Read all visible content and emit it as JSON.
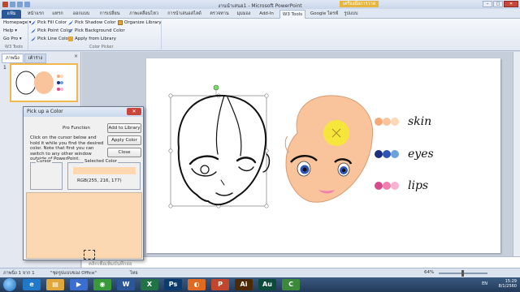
{
  "window": {
    "title": "งานนำเสนอ1 - Microsoft PowerPoint",
    "minimize": "–",
    "maximize": "□",
    "close": "✕"
  },
  "tabs": [
    {
      "label": "แฟ้ม",
      "kind": "file"
    },
    {
      "label": "หน้าแรก"
    },
    {
      "label": "แทรก"
    },
    {
      "label": "ออกแบบ"
    },
    {
      "label": "การเปลี่ยน"
    },
    {
      "label": "ภาพเคลื่อนไหว"
    },
    {
      "label": "การนำเสนอสไลด์"
    },
    {
      "label": "ตรวจทาน"
    },
    {
      "label": "มุมมอง"
    },
    {
      "label": "Add-In"
    },
    {
      "label": "W3 Tools",
      "kind": "active"
    },
    {
      "label": "Google ไดรฟ์"
    },
    {
      "label": "รูปแบบ"
    }
  ],
  "context_tab": "เครื่องมือการวาด",
  "ribbon": {
    "w3tools_group": {
      "items": [
        "Homepage ▾",
        "Help ▾",
        "Go Pro ▾"
      ],
      "name": "W3 Tools"
    },
    "color_picker_group": {
      "items": [
        {
          "label": "Pick Fill Color",
          "icon": "fill-picker-icon"
        },
        {
          "label": "Pick Point Color",
          "icon": "point-picker-icon"
        },
        {
          "label": "Pick Line Color",
          "icon": "line-picker-icon"
        },
        {
          "label": "Pick Shadow Color",
          "icon": "shadow-picker-icon"
        },
        {
          "label": "Pick Background Color",
          "icon": "background-picker-icon"
        },
        {
          "label": "Apply from Library",
          "icon": "library-apply-icon"
        },
        {
          "label": "Organize Library",
          "icon": "organize-library-icon"
        }
      ],
      "name": "Color Picker"
    }
  },
  "leftpane": {
    "tabs": [
      "ภาพนิ่ง",
      "เค้าร่าง"
    ],
    "close": "×",
    "slide_number": "1"
  },
  "slide": {
    "labels": [
      {
        "text": "skin",
        "colors": [
          "#f6a977",
          "#f9c49c",
          "#fcd8b5"
        ]
      },
      {
        "text": "eyes",
        "colors": [
          "#1c2f7c",
          "#2e55b6",
          "#6da3d9"
        ]
      },
      {
        "text": "lips",
        "colors": [
          "#d94a8c",
          "#ef7fae",
          "#f7b3cf"
        ]
      }
    ]
  },
  "dialog": {
    "title": "Pick up a Color",
    "close": "✕",
    "pro_function": "Pro Function",
    "add_to_library": "Add to Library",
    "apply_color": "Apply Color",
    "close_btn": "Close",
    "instructions": "Click on the cursor below and hold it while you find the desired color. Note that first you can switch to any other window outside of PowerPoint.",
    "cursor_label": "Cursor",
    "selected_label": "Selected Color",
    "rgb": "RGB(255, 216, 177)",
    "selected_color": "#ffd8b1"
  },
  "notes": "คลิกเพื่อเพิ่มบันทึกย่อ",
  "status": {
    "slide_info": "ภาพนิ่ง 1 จาก 1",
    "theme": "\"ชุดรูปแบบของ Office\"",
    "language": "ไทย",
    "zoom": "64%"
  },
  "tray": {
    "lang": "EN",
    "time": "15:29",
    "date": "8/1/2560"
  },
  "taskbar_apps": [
    {
      "name": "ie-icon",
      "glyph": "e",
      "color": "#1f78c8"
    },
    {
      "name": "explorer-icon",
      "glyph": "▤",
      "color": "#e0a83a"
    },
    {
      "name": "media-player-icon",
      "glyph": "▶",
      "color": "#3a6fd0"
    },
    {
      "name": "chrome-icon",
      "glyph": "◉",
      "color": "#3a9a3a"
    },
    {
      "name": "word-icon",
      "glyph": "W",
      "color": "#2b579a"
    },
    {
      "name": "excel-icon",
      "glyph": "X",
      "color": "#217346"
    },
    {
      "name": "photoshop-icon",
      "glyph": "Ps",
      "color": "#0b3b6e"
    },
    {
      "name": "firefox-icon",
      "glyph": "◐",
      "color": "#e06a1f"
    },
    {
      "name": "powerpoint-icon",
      "glyph": "P",
      "color": "#c2462c"
    },
    {
      "name": "illustrator-icon",
      "glyph": "Ai",
      "color": "#4b2a05"
    },
    {
      "name": "audition-icon",
      "glyph": "Au",
      "color": "#0d4a3a"
    },
    {
      "name": "camtasia-icon",
      "glyph": "C",
      "color": "#3a8a3a"
    }
  ]
}
